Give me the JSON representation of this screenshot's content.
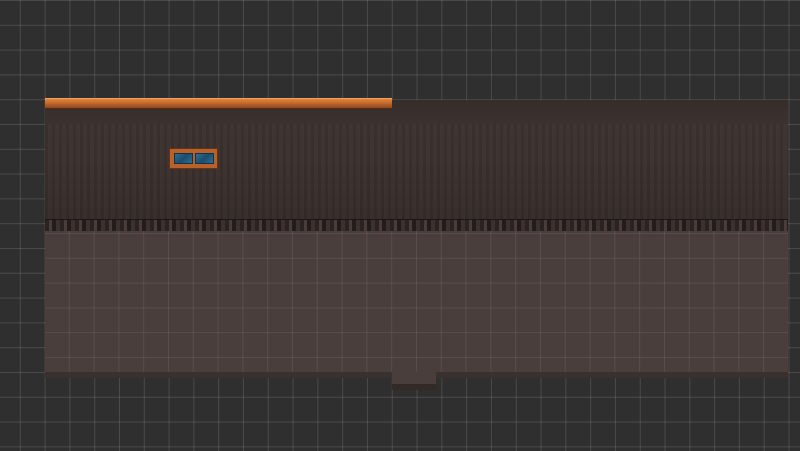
{
  "scene": {
    "type": "2D tile level editor view",
    "colors": {
      "background": "#2f2f30",
      "grid_line": "rgba(255,255,255,0.13)",
      "wall": "#3b3230",
      "floor": "#4a3e3c",
      "wood_beam": "#c4692d",
      "window_glass": "#2d6f96"
    },
    "objects": {
      "beam": "wood-beam",
      "window": "window",
      "floor": "floor-tiles",
      "wall": "back-wall",
      "doorway": "door-notch"
    }
  }
}
